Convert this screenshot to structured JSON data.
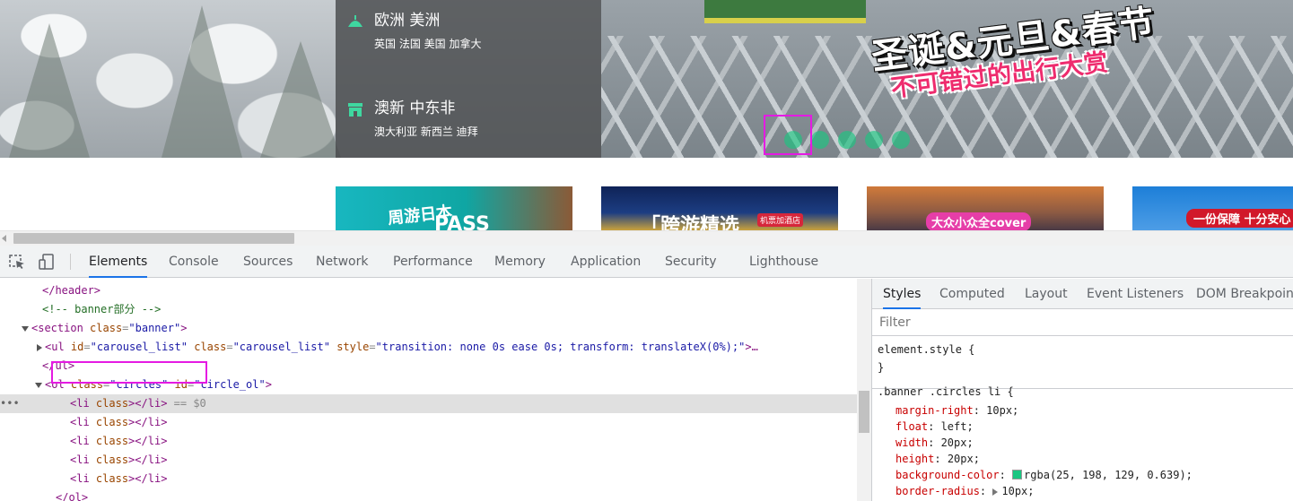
{
  "banner": {
    "regions": [
      {
        "icon": "tower-icon",
        "title": "欧洲 美洲",
        "subtitle": "英国 法国 美国 加拿大"
      },
      {
        "icon": "building-icon",
        "title": "澳新 中东非",
        "subtitle": "澳大利亚 新西兰 迪拜"
      }
    ],
    "promo_title": "圣诞&元旦&春节",
    "promo_subtitle": "不可错过的出行大赏",
    "circle_count": 5,
    "circle_color": "#19c681"
  },
  "thumbnails": [
    {
      "text": "周游日本",
      "sub": "PASS"
    },
    {
      "text": "「跨游精选",
      "badge": "机票加酒店"
    },
    {
      "text": "大众小众全cover"
    },
    {
      "text": "一份保障 十分安心"
    }
  ],
  "devtools": {
    "tabs": [
      "Elements",
      "Console",
      "Sources",
      "Network",
      "Performance",
      "Memory",
      "Application",
      "Security",
      "Lighthouse"
    ],
    "active_tab": "Elements",
    "dom": {
      "l1": "</header>",
      "l2": "<!-- banner部分 -->",
      "l3_tag": "section",
      "l3_attr": "class",
      "l3_val": "\"banner\"",
      "l4_tag": "ul",
      "l4_a1": "id",
      "l4_v1": "\"carousel_list\"",
      "l4_a2": "class",
      "l4_v2": "\"carousel_list\"",
      "l4_a3": "style",
      "l4_v3": "\"transition: none 0s ease 0s; transform: translateX(0%);\"",
      "l4_end": ">…",
      "l5": "</ul>",
      "l6_tag": "ol",
      "l6_a1": "class",
      "l6_v1": "\"circles\"",
      "l6_a2": "id",
      "l6_v2": "\"circle_ol\"",
      "li_tag": "li",
      "li_attr": "class",
      "selected_suffix": "== $0",
      "end_ol": "</ol>"
    },
    "styles": {
      "tabs": [
        "Styles",
        "Computed",
        "Layout",
        "Event Listeners",
        "DOM Breakpoints"
      ],
      "active_tab": "Styles",
      "filter_placeholder": "Filter",
      "element_style_open": "element.style {",
      "element_style_close": "}",
      "rule_selector": ".banner .circles li {",
      "rule_props": [
        {
          "name": "margin-right",
          "value": "10px;"
        },
        {
          "name": "float",
          "value": "left;"
        },
        {
          "name": "width",
          "value": "20px;"
        },
        {
          "name": "height",
          "value": "20px;"
        },
        {
          "name": "background-color",
          "value": "rgba(25, 198, 129, 0.639);"
        },
        {
          "name": "border-radius",
          "value": "10px;"
        }
      ],
      "swatch_color": "#19c681"
    }
  }
}
